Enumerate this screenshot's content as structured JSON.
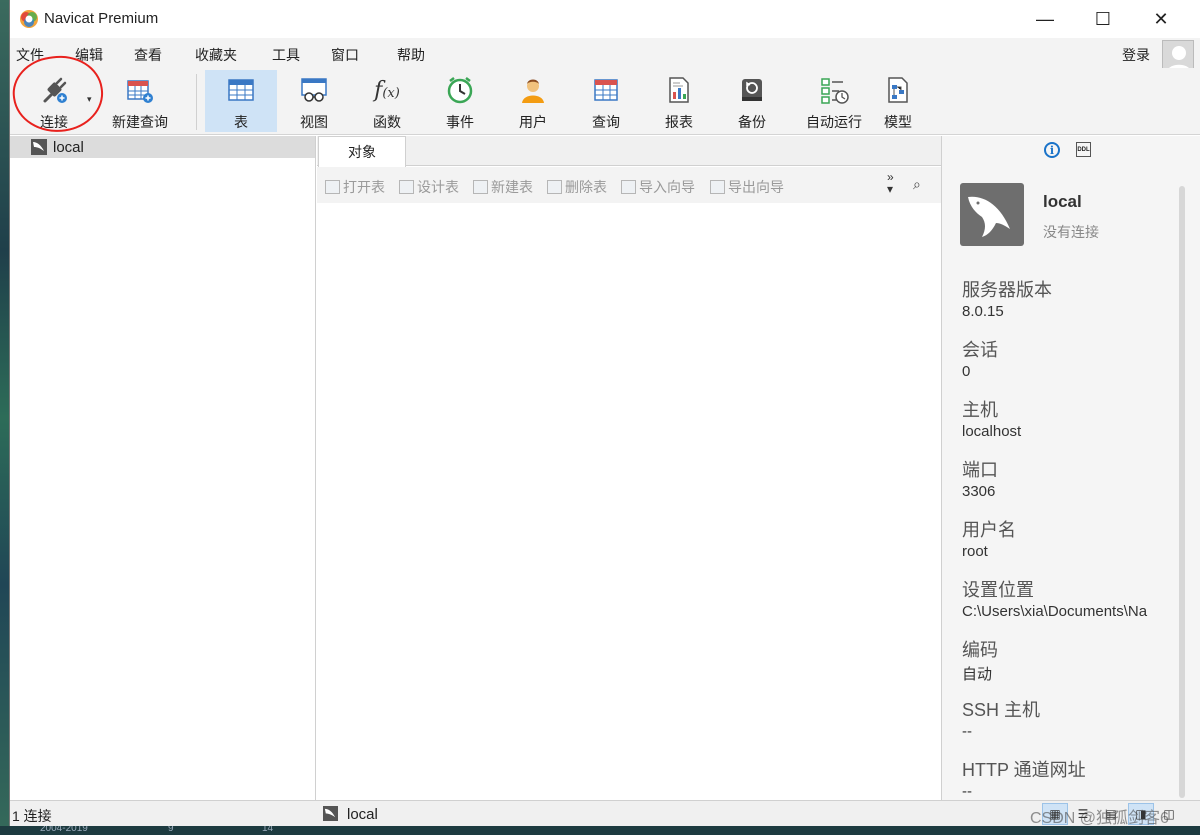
{
  "window": {
    "title": "Navicat Premium",
    "minimize": "—",
    "maximize": "☐",
    "close": "✕"
  },
  "menu": {
    "items": [
      "文件",
      "编辑",
      "查看",
      "收藏夹",
      "工具",
      "窗口",
      "帮助"
    ],
    "login": "登录"
  },
  "toolbar": {
    "connect": "连接",
    "new_query": "新建查询",
    "table": "表",
    "view": "视图",
    "function": "函数",
    "event": "事件",
    "user": "用户",
    "query": "查询",
    "report": "报表",
    "backup": "备份",
    "automation": "自动运行",
    "model": "模型",
    "active": "表"
  },
  "navigator": {
    "items": [
      {
        "label": "local",
        "selected": true
      }
    ]
  },
  "center": {
    "tab": "对象",
    "actions": [
      "打开表",
      "设计表",
      "新建表",
      "删除表",
      "导入向导",
      "导出向导"
    ],
    "more": "»",
    "search_icon": "⌕"
  },
  "info": {
    "connection_name": "local",
    "connection_status": "没有连接",
    "fields": [
      {
        "label": "服务器版本",
        "value": "8.0.15"
      },
      {
        "label": "会话",
        "value": "0"
      },
      {
        "label": "主机",
        "value": "localhost"
      },
      {
        "label": "端口",
        "value": "3306"
      },
      {
        "label": "用户名",
        "value": "root"
      },
      {
        "label": "设置位置",
        "value": "C:\\Users\\xia\\Documents\\Na"
      },
      {
        "label": "编码",
        "value": "自动"
      },
      {
        "label": "SSH 主机",
        "value": "--"
      },
      {
        "label": "HTTP 通道网址",
        "value": "--"
      }
    ]
  },
  "status": {
    "count": "1 连接",
    "current": "local"
  },
  "watermark": "CSDN @独孤剑客6",
  "desktop": {
    "taskbar_fragments": [
      "2004-2019",
      "9",
      "14"
    ]
  },
  "colors": {
    "accent": "#cfe3f6",
    "annotation_circle": "#e8211d",
    "info_blue": "#1a73c9"
  }
}
